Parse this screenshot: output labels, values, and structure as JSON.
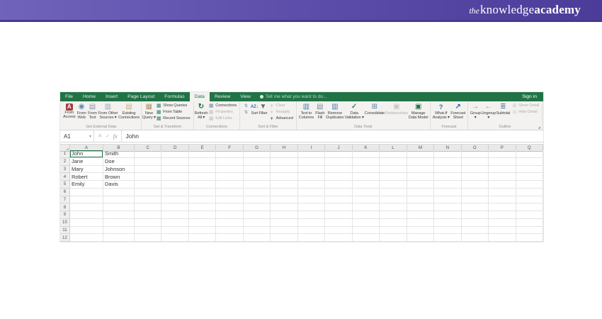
{
  "site_header": {
    "logo_prefix": "the",
    "logo_word1": "knowledge",
    "logo_word2": "academy",
    "bg_left": "#6f63bb",
    "bg_right": "#4a3c98"
  },
  "excel": {
    "colors": {
      "excel_green": "#217346",
      "ribbon_bg": "#f3f2f0"
    },
    "tab_bar": {
      "tabs": [
        {
          "label": "File",
          "active": false
        },
        {
          "label": "Home",
          "active": false
        },
        {
          "label": "Insert",
          "active": false
        },
        {
          "label": "Page Layout",
          "active": false
        },
        {
          "label": "Formulas",
          "active": false
        },
        {
          "label": "Data",
          "active": true
        },
        {
          "label": "Review",
          "active": false
        },
        {
          "label": "View",
          "active": false
        }
      ],
      "tell_me": "Tell me what you want to do...",
      "sign_in": "Sign in"
    },
    "ribbon": {
      "groups": [
        {
          "name": "Get External Data",
          "items": [
            {
              "kind": "large",
              "icon": "from-access-icon",
              "lines": [
                "From",
                "Access"
              ]
            },
            {
              "kind": "large",
              "icon": "from-web-icon",
              "lines": [
                "From",
                "Web"
              ]
            },
            {
              "kind": "large",
              "icon": "from-text-icon",
              "lines": [
                "From",
                "Text"
              ]
            },
            {
              "kind": "large",
              "icon": "from-other-sources-icon",
              "lines": [
                "From Other",
                "Sources ▾"
              ]
            },
            {
              "kind": "large",
              "icon": "existing-connections-icon",
              "lines": [
                "Existing",
                "Connections"
              ]
            }
          ]
        },
        {
          "name": "Get & Transform",
          "items": [
            {
              "kind": "large",
              "icon": "new-query-icon",
              "lines": [
                "New",
                "Query ▾"
              ]
            },
            {
              "kind": "column",
              "items": [
                {
                  "icon": "show-queries-icon",
                  "label": "Show Queries"
                },
                {
                  "icon": "from-table-icon",
                  "label": "From Table"
                },
                {
                  "icon": "recent-sources-icon",
                  "label": "Recent Sources"
                }
              ]
            }
          ]
        },
        {
          "name": "Connections",
          "items": [
            {
              "kind": "large",
              "icon": "refresh-all-icon",
              "lines": [
                "Refresh",
                "All ▾"
              ]
            },
            {
              "kind": "column",
              "items": [
                {
                  "icon": "connections-icon",
                  "label": "Connections"
                },
                {
                  "icon": "properties-icon",
                  "label": "Properties",
                  "disabled": true
                },
                {
                  "icon": "edit-links-icon",
                  "label": "Edit Links",
                  "disabled": true
                }
              ]
            }
          ]
        },
        {
          "name": "Sort & Filter",
          "items": [
            {
              "kind": "column",
              "items": [
                {
                  "icon": "sort-ascending-icon",
                  "label": ""
                },
                {
                  "icon": "sort-descending-icon",
                  "label": ""
                }
              ]
            },
            {
              "kind": "large",
              "icon": "sort-icon",
              "lines": [
                "Sort"
              ]
            },
            {
              "kind": "large",
              "icon": "filter-icon",
              "lines": [
                "Filter"
              ]
            },
            {
              "kind": "column",
              "items": [
                {
                  "icon": "clear-icon",
                  "label": "Clear",
                  "disabled": true
                },
                {
                  "icon": "reapply-icon",
                  "label": "Reapply",
                  "disabled": true
                },
                {
                  "icon": "advanced-icon",
                  "label": "Advanced"
                }
              ]
            }
          ]
        },
        {
          "name": "Data Tools",
          "items": [
            {
              "kind": "large",
              "icon": "text-to-columns-icon",
              "lines": [
                "Text to",
                "Columns"
              ]
            },
            {
              "kind": "large",
              "icon": "flash-fill-icon",
              "lines": [
                "Flash",
                "Fill"
              ]
            },
            {
              "kind": "large",
              "icon": "remove-duplicates-icon",
              "lines": [
                "Remove",
                "Duplicates"
              ]
            },
            {
              "kind": "large",
              "icon": "data-validation-icon",
              "lines": [
                "Data",
                "Validation ▾"
              ]
            },
            {
              "kind": "large",
              "icon": "consolidate-icon",
              "lines": [
                "Consolidate"
              ]
            },
            {
              "kind": "large",
              "icon": "relationships-icon",
              "lines": [
                "Relationships"
              ],
              "disabled": true
            },
            {
              "kind": "large",
              "icon": "manage-data-model-icon",
              "lines": [
                "Manage",
                "Data Model"
              ]
            }
          ]
        },
        {
          "name": "Forecast",
          "items": [
            {
              "kind": "large",
              "icon": "what-if-analysis-icon",
              "lines": [
                "What-If",
                "Analysis ▾"
              ]
            },
            {
              "kind": "large",
              "icon": "forecast-sheet-icon",
              "lines": [
                "Forecast",
                "Sheet"
              ]
            }
          ]
        },
        {
          "name": "Outline",
          "launcher": true,
          "items": [
            {
              "kind": "large",
              "icon": "group-icon",
              "lines": [
                "Group",
                "▾"
              ]
            },
            {
              "kind": "large",
              "icon": "ungroup-icon",
              "lines": [
                "Ungroup",
                "▾"
              ]
            },
            {
              "kind": "large",
              "icon": "subtotal-icon",
              "lines": [
                "Subtotal"
              ]
            },
            {
              "kind": "column",
              "items": [
                {
                  "icon": "show-detail-icon",
                  "label": "Show Detail",
                  "disabled": true
                },
                {
                  "icon": "hide-detail-icon",
                  "label": "Hide Detail",
                  "disabled": true
                }
              ]
            }
          ]
        }
      ]
    },
    "formula_bar": {
      "name_box": "A1",
      "dropdown": "▾",
      "cancel": "✕",
      "enter": "✓",
      "fx": "fx",
      "content": "John"
    },
    "grid": {
      "column_headers": [
        "A",
        "B",
        "C",
        "D",
        "E",
        "F",
        "G",
        "H",
        "I",
        "J",
        "K",
        "L",
        "M",
        "N",
        "O",
        "P",
        "Q"
      ],
      "row_numbers": [
        "1",
        "2",
        "3",
        "4",
        "5",
        "6",
        "7",
        "8",
        "9",
        "10",
        "11",
        "12"
      ],
      "data": [
        [
          "John",
          "Smith"
        ],
        [
          "Jane",
          "Doe"
        ],
        [
          "Mary",
          "Johnson"
        ],
        [
          "Robert",
          "Brown"
        ],
        [
          "Emily",
          "Davis"
        ]
      ],
      "selected_cell": "A1"
    }
  }
}
